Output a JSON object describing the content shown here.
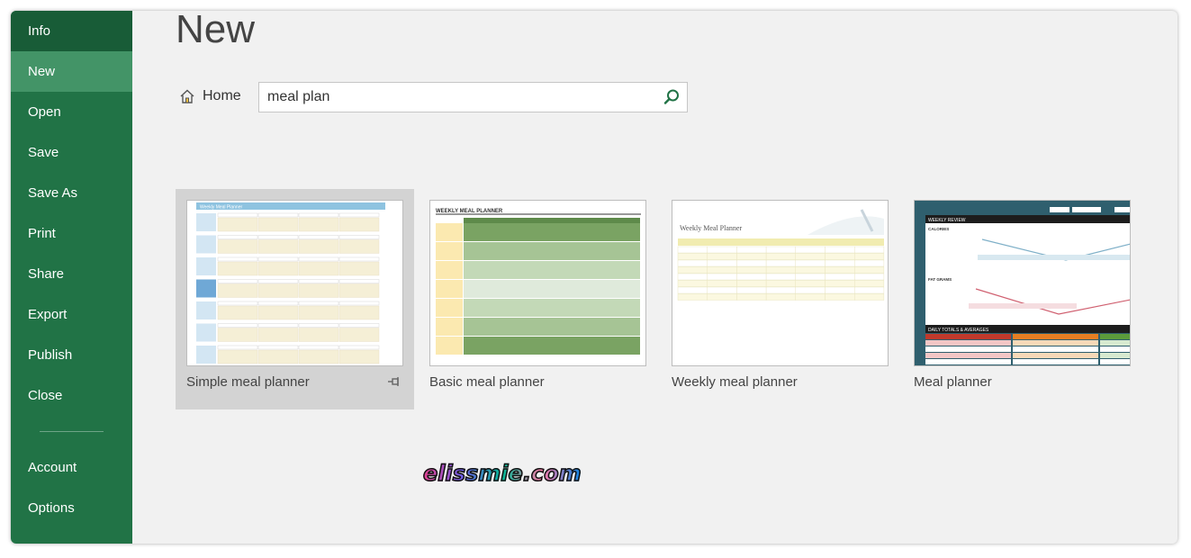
{
  "sidebar": {
    "items": [
      {
        "label": "Info"
      },
      {
        "label": "New"
      },
      {
        "label": "Open"
      },
      {
        "label": "Save"
      },
      {
        "label": "Save As"
      },
      {
        "label": "Print"
      },
      {
        "label": "Share"
      },
      {
        "label": "Export"
      },
      {
        "label": "Publish"
      },
      {
        "label": "Close"
      }
    ],
    "bottom_items": [
      {
        "label": "Account"
      },
      {
        "label": "Options"
      }
    ]
  },
  "page": {
    "title": "New",
    "home_label": "Home"
  },
  "search": {
    "value": "meal plan"
  },
  "templates": [
    {
      "label": "Simple meal planner",
      "thumb_title": "Weekly Meal Planner"
    },
    {
      "label": "Basic meal planner",
      "thumb_title": "WEEKLY MEAL PLANNER"
    },
    {
      "label": "Weekly meal planner",
      "thumb_title": "Weekly Meal Planner"
    },
    {
      "label": "Meal planner",
      "thumb_title": "WEEKLY REVIEW",
      "thumb_sub1": "CALORIES",
      "thumb_sub2": "FAT GRAMS",
      "thumb_sub3": "DAILY TOTALS & AVERAGES"
    }
  ],
  "watermark": "elissmie.com",
  "colors": {
    "sidebar": "#217346",
    "sidebar_dark": "#185c37",
    "sidebar_active": "#439467",
    "background": "#f1f1f1",
    "selected_card": "#d3d3d3"
  }
}
